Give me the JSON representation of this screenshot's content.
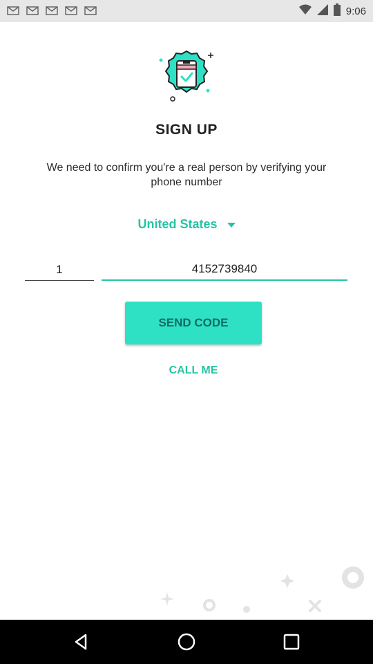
{
  "status_bar": {
    "time": "9:06",
    "left_icons": [
      "mail-icon",
      "mail-icon",
      "mail-icon",
      "mail-icon",
      "mail-icon"
    ],
    "right_icons": [
      "wifi-icon",
      "signal-icon",
      "battery-icon"
    ]
  },
  "header": {
    "logo_icon": "phone-verified-badge-icon",
    "title": "SIGN UP",
    "subtitle": "We need to confirm you're a real person by verifying your phone number"
  },
  "form": {
    "country": "United States",
    "country_code_value": "1",
    "phone_value": "4152739840",
    "send_code_label": "SEND CODE",
    "call_me_label": "CALL ME"
  },
  "decorations": [
    "ring-icon",
    "diamond-sparkle-icon",
    "ring-icon",
    "dot-icon",
    "sparkle-icon",
    "cross-icon"
  ],
  "nav_bar": {
    "buttons": [
      "back-icon",
      "home-icon",
      "recents-icon"
    ]
  },
  "colors": {
    "accent": "#26c4a4",
    "button_bg": "#2ee0c4",
    "button_text": "#0f6e5f",
    "status_bar_bg": "#e7e7e7",
    "nav_bar_bg": "#000000"
  }
}
